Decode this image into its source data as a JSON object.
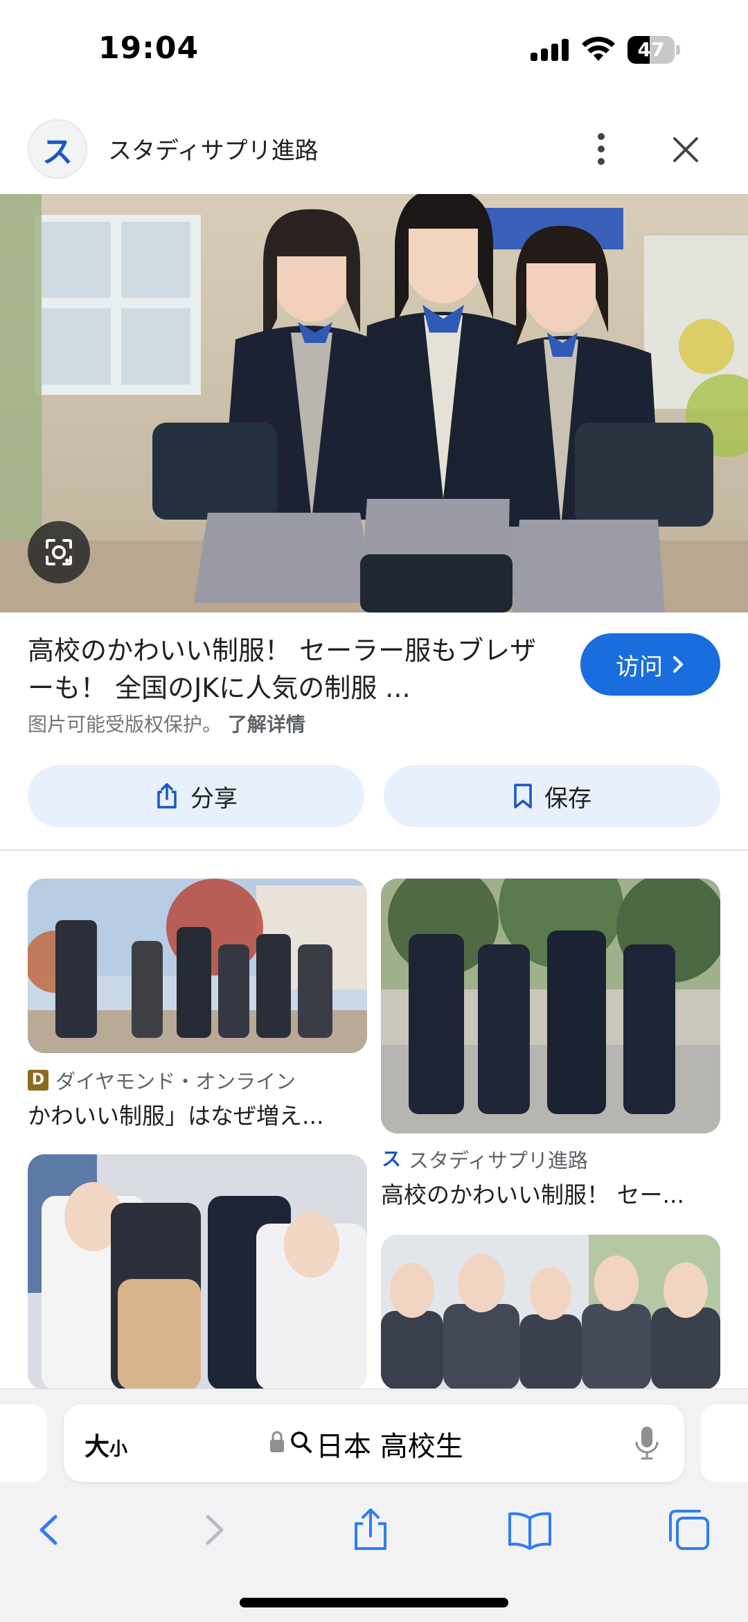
{
  "status_bar": {
    "time": "19:04",
    "battery": "47",
    "battery_level": 0.47
  },
  "source": {
    "logo_letter": "ス",
    "site_name": "スタディサプリ進路"
  },
  "result": {
    "title": "高校のかわいい制服！ セーラー服もブレザーも！ 全国のJKに人気の制服 ...",
    "visit_label": "访问",
    "copyright_notice": "图片可能受版权保护。",
    "learn_more": "了解详情",
    "share_label": "分享",
    "save_label": "保存"
  },
  "related": [
    {
      "source": "ダイヤモンド・オンライン",
      "source_icon": "D",
      "title": "かわいい制服」はなぜ増え..."
    },
    {
      "source": "スタディサプリ進路",
      "source_icon": "ス",
      "title": "高校のかわいい制服！ セー..."
    }
  ],
  "browser": {
    "text_size_label_big": "大",
    "text_size_label_small": "小",
    "url_query": "日本 高校生"
  },
  "colors": {
    "accent": "#1a6ddd",
    "chip_bg": "#e8f0fe",
    "toolbar_icon": "#2f7cf6"
  }
}
